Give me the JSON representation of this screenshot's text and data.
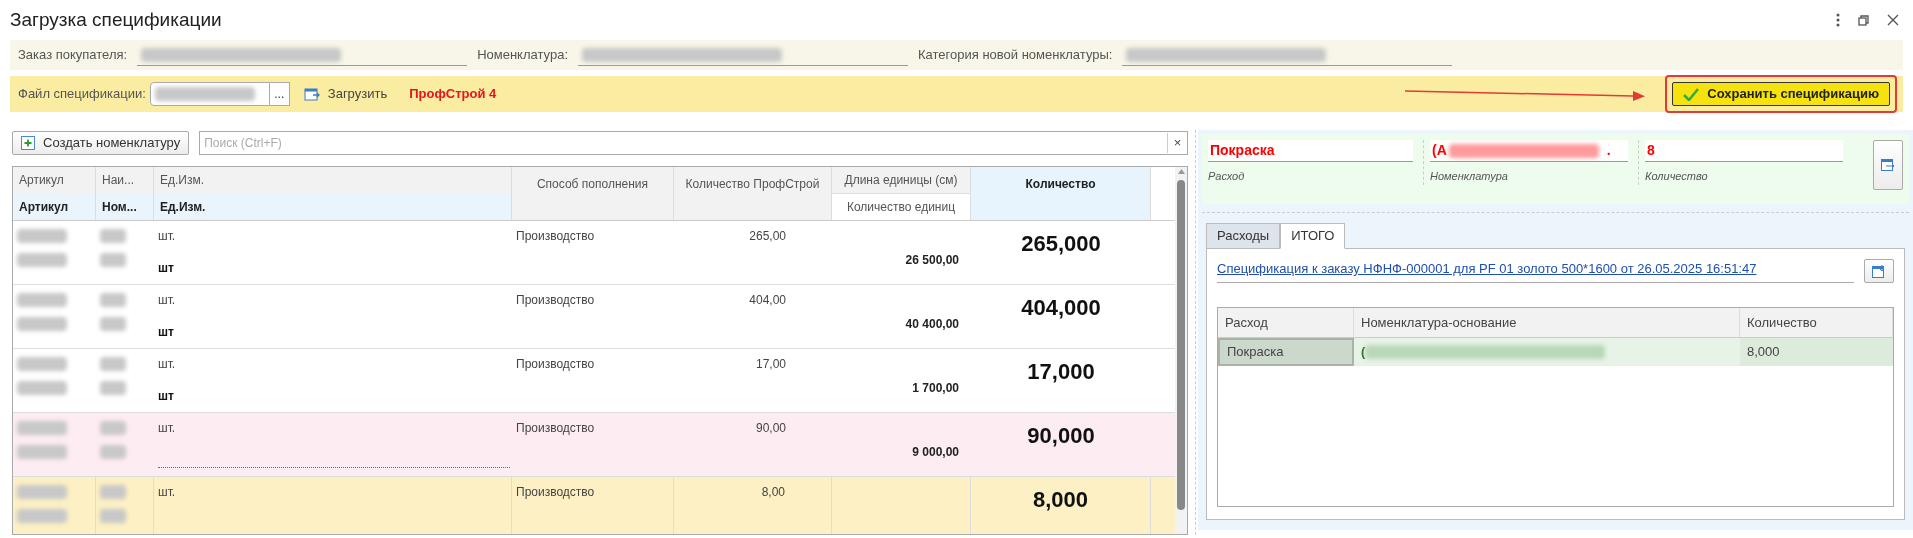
{
  "window": {
    "title": "Загрузка спецификации"
  },
  "header_fields": [
    {
      "label": "Заказ покупателя:"
    },
    {
      "label": "Номенклатура:"
    },
    {
      "label": "Категория новой номенклатуры:"
    }
  ],
  "file_bar": {
    "label": "Файл спецификации:",
    "browse": "...",
    "load_button": "Загрузить",
    "format": "ПрофСтрой 4",
    "save_button": "Сохранить спецификацию"
  },
  "toolbar": {
    "create_button": "Создать номенклатуру",
    "search_placeholder": "Поиск (Ctrl+F)",
    "clear": "×"
  },
  "table": {
    "columns": [
      {
        "label": "Артикул",
        "sublabel": "Артикул"
      },
      {
        "label": "Наи...",
        "sublabel": "Ном..."
      },
      {
        "label": "Ед.Изм.",
        "sublabel": "Ед.Изм."
      },
      {
        "label": "Способ пополнения"
      },
      {
        "label": "Количество ПрофСтрой"
      },
      {
        "label": "Длина единицы (см)",
        "sublabel": "Количество единиц"
      },
      {
        "label": "Количество"
      }
    ],
    "rows": [
      {
        "unit": "шт.",
        "unit2": "шт",
        "method": "Производство",
        "qty_pf": "265,00",
        "units": "26 500,00",
        "qty": "265,000",
        "error": false,
        "selected": false
      },
      {
        "unit": "шт.",
        "unit2": "шт",
        "method": "Производство",
        "qty_pf": "404,00",
        "units": "40 400,00",
        "qty": "404,000",
        "error": false,
        "selected": false
      },
      {
        "unit": "шт.",
        "unit2": "шт",
        "method": "Производство",
        "qty_pf": "17,00",
        "units": "1 700,00",
        "qty": "17,000",
        "error": false,
        "selected": false
      },
      {
        "unit": "шт.",
        "method": "Производство",
        "qty_pf": "90,00",
        "units": "9 000,00",
        "qty": "90,000",
        "error": true,
        "selected": false
      },
      {
        "unit": "шт.",
        "method": "Производство",
        "qty_pf": "8,00",
        "qty": "8,000",
        "error": false,
        "selected": true
      }
    ]
  },
  "detail": {
    "fields": [
      {
        "value": "Покраска",
        "caption": "Расход"
      },
      {
        "value": "(А",
        "caption": "Номенклатура",
        "tail": "."
      },
      {
        "value": "8",
        "caption": "Количество"
      }
    ],
    "tabs": [
      {
        "label": "Расходы",
        "selected": false
      },
      {
        "label": "ИТОГО",
        "selected": true
      }
    ],
    "link": "Спецификация к заказу НФНФ-000001 для PF 01 золото  500*1600 от 26.05.2025 16:51:47",
    "table": {
      "columns": [
        "Расход",
        "Номенклатура-основание",
        "Количество"
      ],
      "rows": [
        {
          "expense": "Покраска",
          "base": "(",
          "qty": "8,000",
          "selected": true
        }
      ]
    }
  }
}
